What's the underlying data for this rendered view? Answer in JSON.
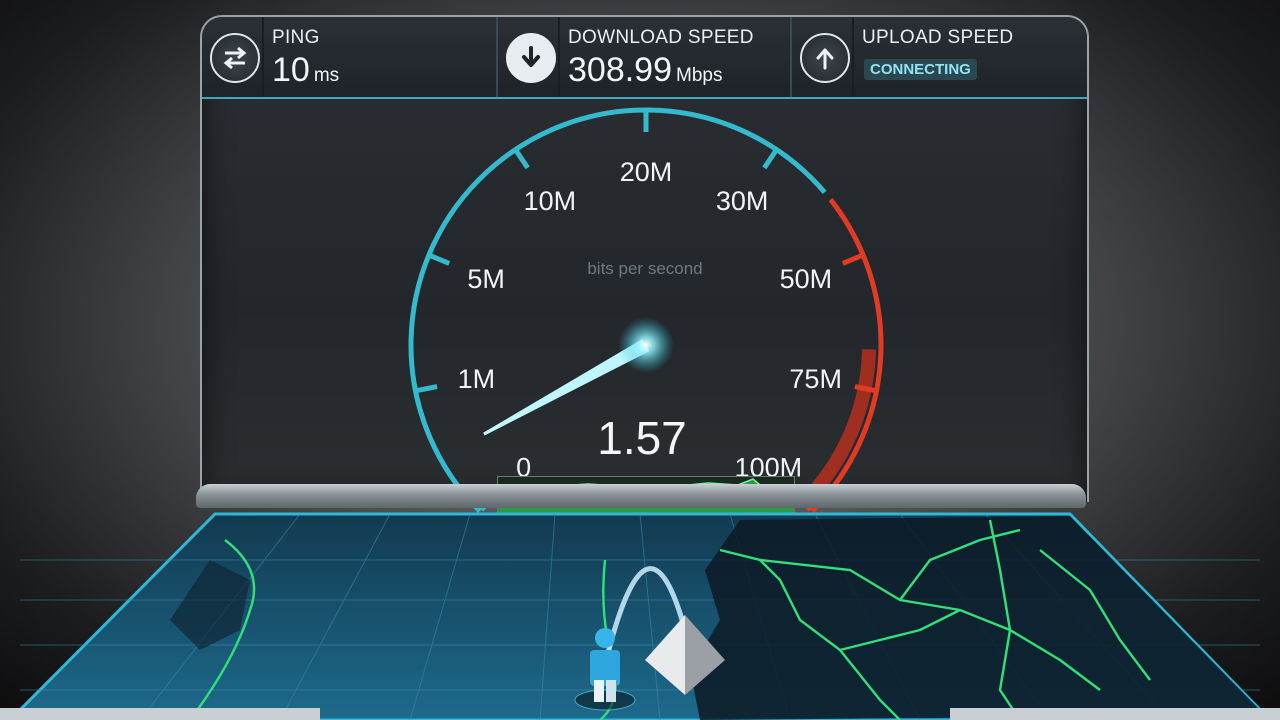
{
  "ping": {
    "label": "PING",
    "value": "10",
    "unit": "ms",
    "icon": "ping-exchange-icon"
  },
  "download": {
    "label": "DOWNLOAD SPEED",
    "value": "308.99",
    "unit": "Mbps",
    "icon": "download-arrow-icon"
  },
  "upload": {
    "label": "UPLOAD SPEED",
    "status": "CONNECTING",
    "icon": "upload-arrow-icon"
  },
  "gauge": {
    "caption": "bits per second",
    "reading": "1.57",
    "ticks": [
      {
        "label": "0",
        "danger": false
      },
      {
        "label": "1M",
        "danger": false
      },
      {
        "label": "5M",
        "danger": false
      },
      {
        "label": "10M",
        "danger": false
      },
      {
        "label": "20M",
        "danger": false
      },
      {
        "label": "30M",
        "danger": false
      },
      {
        "label": "50M",
        "danger": true
      },
      {
        "label": "75M",
        "danger": true
      },
      {
        "label": "100M",
        "danger": true
      }
    ],
    "needle_value_fraction": 0.06,
    "colors": {
      "normal": "#35b9cc",
      "danger": "#e23b24",
      "needle": "#bff6ff"
    }
  },
  "map": {
    "accent": "#1b6f8e",
    "border_color": "#2fe07a"
  }
}
